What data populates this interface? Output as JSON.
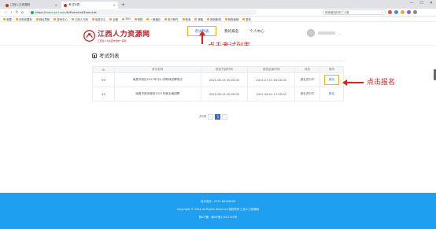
{
  "browser": {
    "tabs": [
      {
        "label": "江西人力资源网",
        "active": false
      },
      {
        "label": "考试列表",
        "active": true
      }
    ],
    "new_tab": "+",
    "window_controls": [
      "—",
      "☐",
      "✕"
    ],
    "url_prefix": "https://",
    "url_host": "exam.jxrl.com",
    "url_path": "/#/ExamList/ExamList",
    "search_placeholder": "夏瑜增加的伤亡人数",
    "bookmarks": [
      "收藏",
      "手机收藏夹",
      "网址导航",
      "游戏中心",
      "江西人力网",
      "信息中心",
      "百度",
      "360",
      "购物",
      "一网通办",
      "电子邮件",
      "新浪",
      "博客",
      "新浪新闻",
      "网络营销",
      "更多"
    ]
  },
  "site": {
    "logo_name": "江西人力资源网",
    "logo_sub": "江西省人力资源市场统一官网",
    "nav": [
      {
        "label": "考试列表",
        "active": true
      },
      {
        "label": "我的报名",
        "active": false
      },
      {
        "label": "个人中心",
        "active": false
      }
    ],
    "user_caret": "⌄"
  },
  "annotations": {
    "click_exam_list": "点击考试列表",
    "click_register": "点击报名"
  },
  "page": {
    "title": "考试列表",
    "table": {
      "headers": [
        "ID",
        "考试名称",
        "报名开始时间",
        "报名结束时间",
        "状态",
        "操作"
      ],
      "rows": [
        {
          "id": "50",
          "name": "南昌市新区2021年中小学教师招聘笔试",
          "start": "2021-06-15 00:00:00",
          "end": "2021-07-01 00:00:00",
          "status": "报名进行中",
          "op": "报名",
          "highlight": true
        },
        {
          "id": "45",
          "name": "南昌市政务服务2021年事业编招聘",
          "start": "2021-06-15 00:00:00",
          "end": "2021-06-21 17:00:00",
          "status": "报名进行中",
          "op": "报名",
          "highlight": false
        }
      ]
    },
    "pager": {
      "total": "共2条",
      "prev": "‹",
      "current": "1",
      "next": "›"
    }
  },
  "footer": {
    "line1": "技术支持：0791-88158008",
    "line2": "Copyright © 2021 All Rights Reserved 版权所有 江西人力资源网",
    "line3": "赣ICP备：赣ICP备12001143号"
  },
  "colors": {
    "brand_red": "#c8161d",
    "link_blue": "#2b6fd6",
    "highlight_yellow": "#f5b400",
    "annotation_red": "#e02020",
    "footer_blue": "#1f9ff0"
  }
}
